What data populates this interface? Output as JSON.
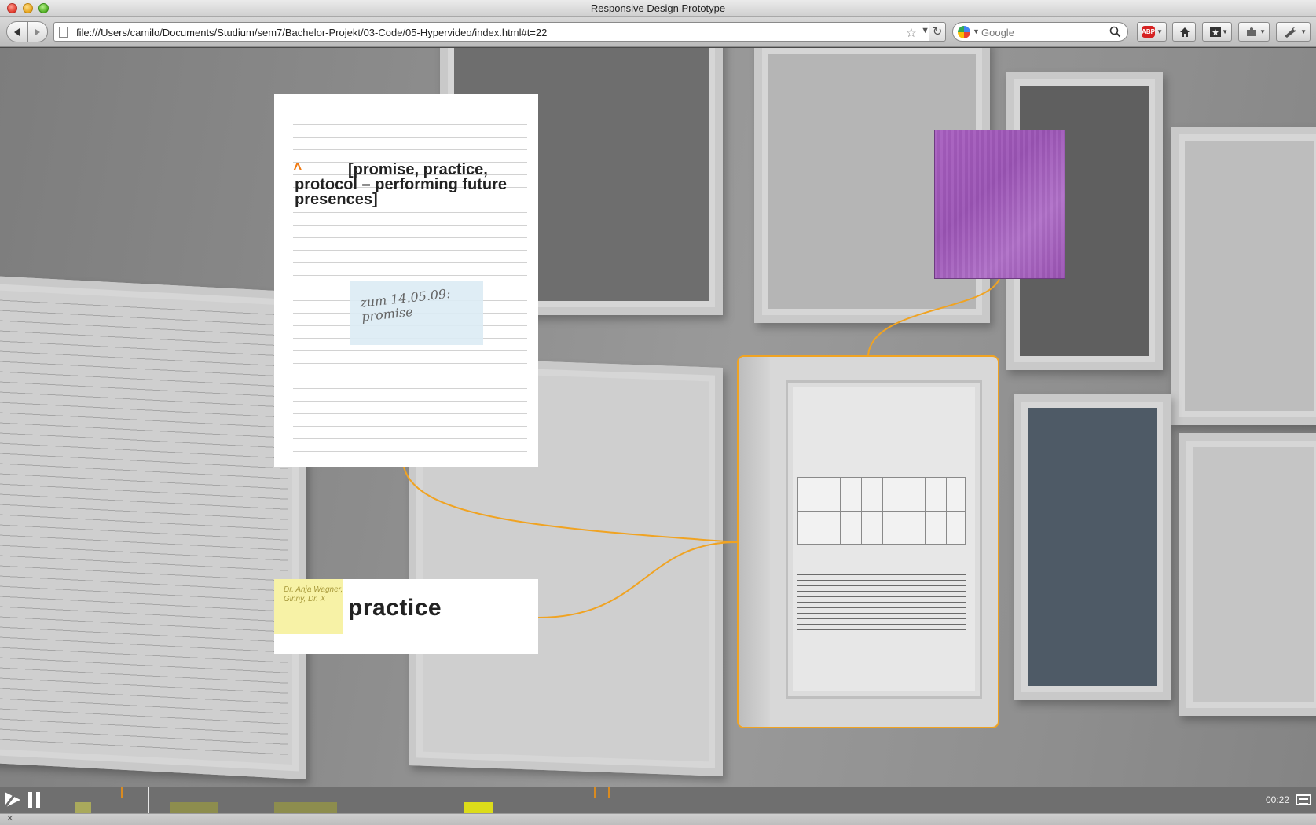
{
  "window": {
    "title": "Responsive Design Prototype"
  },
  "toolbar": {
    "url": "file:///Users/camilo/Documents/Studium/sem7/Bachelor-Projekt/03-Code/05-Hypervideo/index.html#t=22",
    "search_placeholder": "Google",
    "abp_label": "ABP"
  },
  "video": {
    "doc_card": {
      "title": "[promise, practice, protocol – performing future presences]",
      "caret": "^",
      "note": "zum 14.05.09: promise"
    },
    "word_card": {
      "word": "practice",
      "postit": "Dr. Anja Wagner, Ginny, Dr. X"
    },
    "highlight_color": "#f0a322",
    "purple_color": "#a35cbd"
  },
  "controls": {
    "time": "00:22",
    "play_icon": "play-icon",
    "pause_icon": "pause-icon",
    "cc_icon": "captions-icon",
    "timeline": {
      "playhead_fraction": 0.079,
      "segments": [
        {
          "kind": "light",
          "color": "#a9a95c"
        },
        {
          "kind": "mid",
          "color": "#8d8d4e"
        },
        {
          "kind": "mid",
          "color": "#8d8d4e"
        },
        {
          "kind": "bright",
          "color": "#dcdc1a"
        }
      ],
      "marker_color": "#d98b21"
    }
  }
}
